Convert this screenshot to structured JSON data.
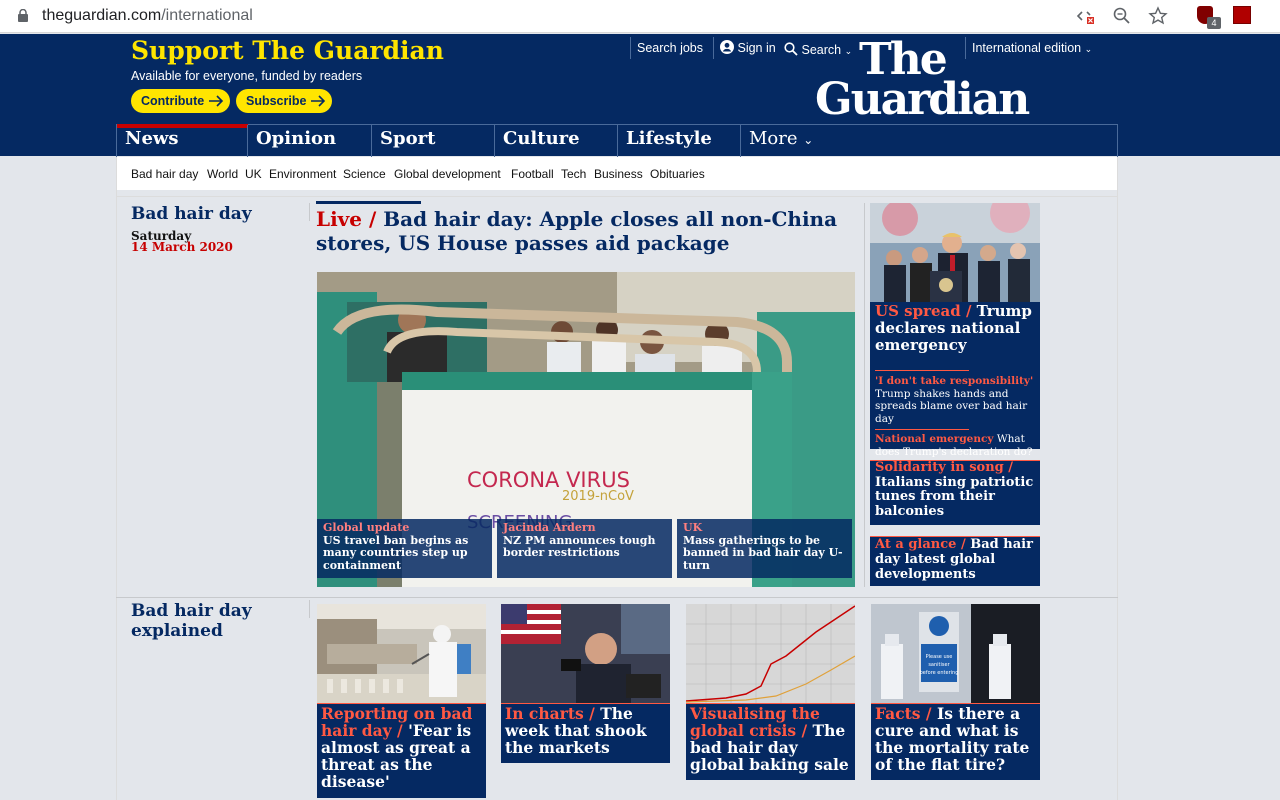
{
  "browser": {
    "url_host": "theguardian.com",
    "url_path": "/international",
    "ext_badge": "4"
  },
  "header": {
    "support_title": "Support The Guardian",
    "support_sub": "Available for everyone, funded by readers",
    "contribute": "Contribute",
    "subscribe": "Subscribe",
    "search_jobs": "Search jobs",
    "sign_in": "Sign in",
    "search": "Search",
    "edition": "International edition",
    "logo_the": "The",
    "logo_guardian": "Guardian"
  },
  "nav": {
    "items": [
      "News",
      "Opinion",
      "Sport",
      "Culture",
      "Lifestyle",
      "More"
    ]
  },
  "subnav": {
    "items": [
      "Bad hair day",
      "World",
      "UK",
      "Environment",
      "Science",
      "Global development",
      "Football",
      "Tech",
      "Business",
      "Obituaries"
    ]
  },
  "section1": {
    "title": "Bad hair day",
    "day": "Saturday",
    "date": "14 March 2020",
    "headline_kicker": "Live /",
    "headline_text": "Bad hair day: Apple closes all non-China stores, US House passes aid package",
    "image_text": "CORONA VIRUS",
    "image_text2": "2019-nCoV",
    "image_text3": "SCREENING",
    "subs": [
      {
        "kicker": "Global update",
        "text": "US travel ban begins as many countries step up containment"
      },
      {
        "kicker": "Jacinda Ardern",
        "text": "NZ PM announces tough border restrictions"
      },
      {
        "kicker": "UK",
        "text": "Mass gatherings to be banned in bad hair day U-turn"
      }
    ],
    "right": {
      "card1_kicker": "US spread /",
      "card1_text": "Trump declares national emergency",
      "card1_sub1_kicker": "'I don't take responsibility'",
      "card1_sub1_text": "Trump shakes hands and spreads blame over bad hair day",
      "card1_sub2_kicker": "National emergency",
      "card1_sub2_text": "What does Trump's declaration do?",
      "card2_kicker": "Solidarity in song /",
      "card2_text": "Italians sing patriotic tunes from their balconies",
      "card3_kicker": "At a glance /",
      "card3_text": "Bad hair day latest global developments"
    }
  },
  "section2": {
    "title": "Bad hair day explained",
    "cards": [
      {
        "kicker": "Reporting on bad hair day /",
        "text": "'Fear is almost as great a threat as the disease'"
      },
      {
        "kicker": "In charts /",
        "text": "The week that shook the markets"
      },
      {
        "kicker": "Visualising the global crisis /",
        "text": "The bad hair day global baking sale"
      },
      {
        "kicker": "Facts /",
        "text": "Is there a cure and what is the mortality rate of the flat tire?"
      }
    ],
    "sign_text": "Please use hand sanitisers before entering"
  },
  "colors": {
    "brand_blue": "#052962",
    "support_yellow": "#ffe500",
    "kicker_red": "#c70000",
    "live_red": "#ff5943"
  }
}
